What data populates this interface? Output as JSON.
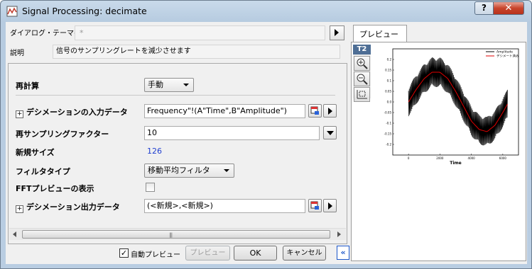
{
  "window": {
    "title": "Signal Processing: decimate",
    "help_glyph": "?",
    "close_glyph": "✕"
  },
  "theme": {
    "label": "ダイアログ・テーマ(H)",
    "value": "*"
  },
  "description": {
    "label": "説明",
    "value": "信号のサンプリングレートを減少させます"
  },
  "settings": {
    "recalc": {
      "label": "再計算",
      "value": "手動"
    },
    "input": {
      "label": "デシメーションの入力データ",
      "value": "Frequency\"!(A\"Time\",B\"Amplitude\")",
      "expander": "⊞"
    },
    "factor": {
      "label": "再サンプリングファクター",
      "value": "10"
    },
    "newsize": {
      "label": "新規サイズ",
      "value": "126"
    },
    "filter": {
      "label": "フィルタタイプ",
      "value": "移動平均フィルタ"
    },
    "fft": {
      "label": "FFTプレビューの表示",
      "checked": false
    },
    "output": {
      "label": "デシメーション出力データ",
      "value": "(<新規>,<新規>)",
      "expander": "⊞"
    }
  },
  "scroll_grip": "|||",
  "bottom": {
    "auto_preview_label": "自動プレビュー",
    "auto_preview_checked": true,
    "check_glyph": "✓",
    "preview_button": "プレビュー",
    "ok_button": "OK",
    "cancel_button": "キャンセル",
    "collapse_glyph": "«"
  },
  "preview": {
    "tab_label": "プレビュー",
    "tool_label": "T2",
    "colors": {
      "amplitude": "#000000",
      "decimated": "#e00000"
    },
    "chart_data": {
      "type": "line",
      "xlabel": "Time",
      "ylim": [
        -0.25,
        0.25
      ],
      "yticks": [
        "0.2",
        "0.15",
        "0.1",
        "0.05",
        "0.0",
        "-0.05",
        "-0.1",
        "-0.15",
        "-0.2"
      ],
      "xticks": [
        "0",
        "2000",
        "4000",
        "6000"
      ],
      "xlim": [
        -1000,
        7000
      ],
      "legend": {
        "position": "top-right"
      },
      "series": [
        {
          "name": "Amplitude",
          "x": [
            0,
            500,
            1000,
            1500,
            2000,
            2500,
            3000,
            3500,
            4000,
            4500,
            5000,
            5500,
            6000,
            6300
          ],
          "y": [
            0.0,
            0.06,
            0.11,
            0.14,
            0.14,
            0.11,
            0.05,
            -0.02,
            -0.09,
            -0.13,
            -0.14,
            -0.11,
            -0.05,
            -0.01
          ],
          "band": 0.07
        },
        {
          "name": "デシメート済み",
          "x": [
            0,
            500,
            1000,
            1500,
            2000,
            2500,
            3000,
            3500,
            4000,
            4500,
            5000,
            5500,
            6000,
            6300
          ],
          "y": [
            0.0,
            0.06,
            0.11,
            0.14,
            0.14,
            0.11,
            0.05,
            -0.02,
            -0.09,
            -0.13,
            -0.14,
            -0.11,
            -0.05,
            -0.01
          ]
        }
      ]
    }
  }
}
